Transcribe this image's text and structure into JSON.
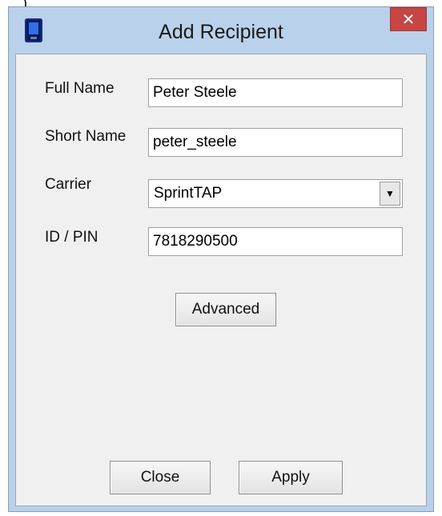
{
  "window": {
    "title": "Add Recipient",
    "close_glyph": "✕",
    "icon": "pager-device-icon"
  },
  "stray_glyph": ")",
  "form": {
    "full_name": {
      "label": "Full Name",
      "value": "Peter Steele"
    },
    "short_name": {
      "label": "Short Name",
      "value": "peter_steele"
    },
    "carrier": {
      "label": "Carrier",
      "value": "SprintTAP",
      "arrow": "▼"
    },
    "id_pin": {
      "label": "ID / PIN",
      "value": "7818290500"
    }
  },
  "buttons": {
    "advanced": "Advanced",
    "close": "Close",
    "apply": "Apply"
  },
  "colors": {
    "frame": "#b9d1ea",
    "close_button": "#c74543",
    "client": "#f0f0f0"
  }
}
